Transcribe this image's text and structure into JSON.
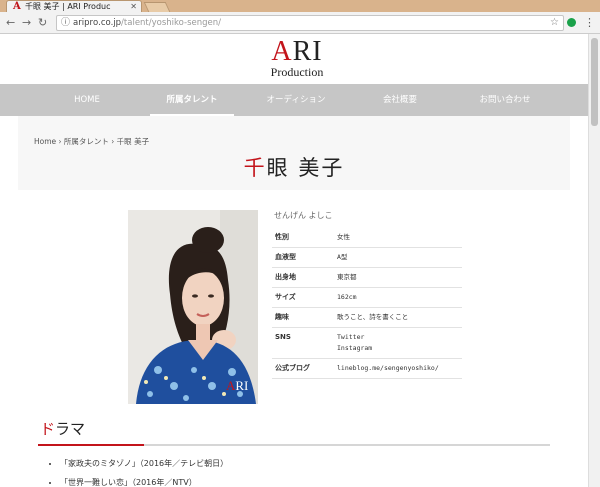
{
  "browser": {
    "tab_title": "千眼 美子 | ARI Produc",
    "tab_favicon": "A",
    "url_host": "ariprо.co.jp",
    "url_path": "/talent/yoshiko-sengen/"
  },
  "logo": {
    "line1_a": "A",
    "line1_rest": "RI",
    "line2": "Production"
  },
  "nav": {
    "items": [
      "HOME",
      "所属タレント",
      "オーディション",
      "会社概要",
      "お問い合わせ"
    ],
    "active_index": 1
  },
  "breadcrumb": "Home › 所属タレント › 千眼 美子",
  "title": {
    "first": "千",
    "rest": "眼 美子"
  },
  "profile": {
    "kana": "せんげん よしこ",
    "rows": [
      {
        "key": "性別",
        "value": "女性"
      },
      {
        "key": "血液型",
        "value": "A型"
      },
      {
        "key": "出身地",
        "value": "東京都"
      },
      {
        "key": "サイズ",
        "value": "162cm"
      },
      {
        "key": "趣味",
        "value": "歌うこと、詩を書くこと"
      },
      {
        "key": "SNS",
        "value": "Twitter",
        "value2": "Instagram"
      },
      {
        "key": "公式ブログ",
        "value": "lineblog.me/sengenyoshiko/"
      }
    ],
    "photo_logo": {
      "a": "A",
      "rest": "RI"
    }
  },
  "drama": {
    "title_first": "ド",
    "title_rest": "ラマ",
    "items": [
      "「家政夫のミタゾノ」（2016年／テレビ朝日）",
      "「世界一難しい恋」（2016年／NTV）"
    ]
  },
  "colors": {
    "accent": "#c3141b",
    "nav_bg": "#c6c6c6"
  }
}
